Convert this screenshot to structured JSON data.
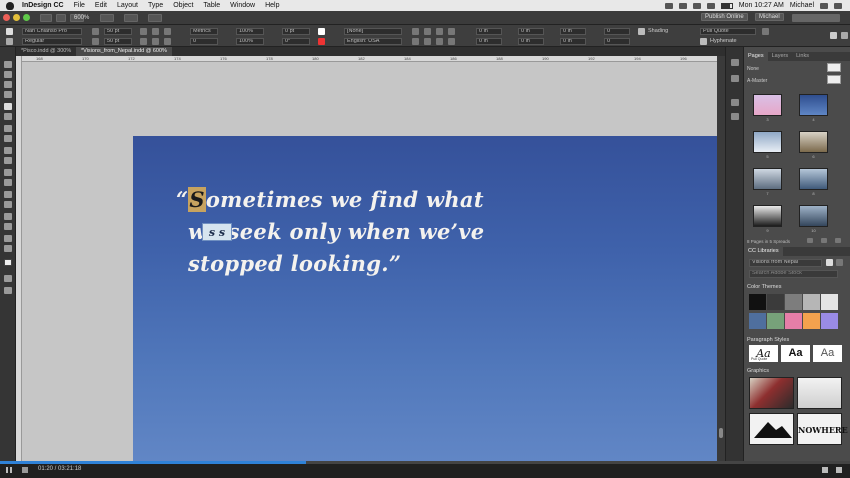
{
  "menubar": {
    "app_name": "InDesign CC",
    "items": [
      "File",
      "Edit",
      "Layout",
      "Type",
      "Object",
      "Table",
      "Window",
      "Help"
    ],
    "clock": "Mon 10:27 AM",
    "user": "Michael"
  },
  "appbar": {
    "zoom": "600%",
    "publish_label": "Publish Online",
    "user_label": "Michael"
  },
  "control": {
    "font_family": "Nan Chianso Pro",
    "font_style": "Regular",
    "font_size": "50 pt",
    "leading": "50 pt",
    "kerning": "Metrics",
    "tracking": "0",
    "vscale": "100%",
    "hscale": "100%",
    "baseline": "0 pt",
    "skew": "0°",
    "char_style": "[None]",
    "language": "English: USA",
    "indent_left": "0 in",
    "indent_right": "0 in",
    "space_before": "0 in",
    "space_after": "0 in",
    "shading_label": "Shading",
    "para_style": "Pull Quote",
    "hyphenate_label": "Hyphenate"
  },
  "doc_tabs": [
    {
      "label": "*Pisco.indd @ 300%"
    },
    {
      "label": "*Visions_from_Nepal.indd @ 600%"
    }
  ],
  "ruler_numbers": [
    "168",
    "170",
    "172",
    "174",
    "176",
    "178",
    "180",
    "182",
    "184",
    "186",
    "188",
    "190",
    "192",
    "194",
    "196"
  ],
  "quote": {
    "open_mark": "“",
    "cursor_letter": "S",
    "line1_rest": "ometimes we find what",
    "line2": "we seek only when we’ve",
    "line3": "stopped looking.”"
  },
  "glyph_popup": "s s",
  "panel": {
    "tabs": [
      "Pages",
      "Layers",
      "Links"
    ],
    "masters": [
      "None",
      "A-Master"
    ],
    "page_numbers": [
      "3",
      "4",
      "5",
      "6",
      "7",
      "8",
      "9",
      "10"
    ],
    "pages_status": "8 Pages in 5 Spreads",
    "cc_libraries_title": "CC Libraries",
    "library_name": "Visions from Nepal",
    "search_placeholder": "Search Adobe Stock",
    "color_themes_label": "Color Themes",
    "swatches_row1": [
      "#111111",
      "#3b3b3b",
      "#7d7d7d",
      "#b6b6b6",
      "#e4e4e4"
    ],
    "swatches_row2": [
      "#4f6f9e",
      "#77a27a",
      "#e67ea8",
      "#f3a24e",
      "#9a8be6"
    ],
    "paragraph_styles_label": "Paragraph Styles",
    "paragraph_styles": [
      "Aa",
      "Aa",
      "Aa"
    ],
    "pull_quote_label": "Pull Quote",
    "graphics_label": "Graphics",
    "graphic_text": "NOWHERE"
  },
  "bottombar": {
    "timecode": "01:20 / 03:21:18",
    "progress": 0.36
  }
}
